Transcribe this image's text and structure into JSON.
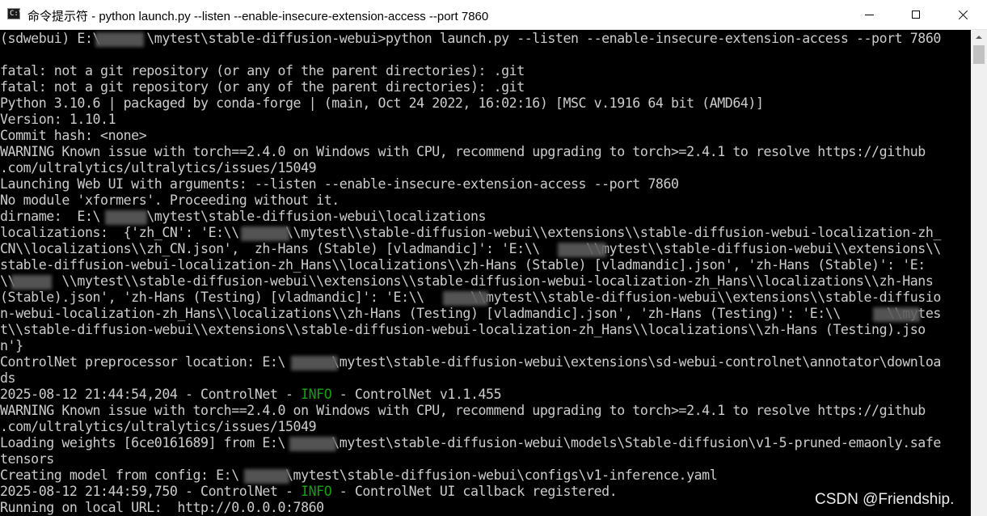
{
  "window": {
    "title": "命令提示符 - python  launch.py --listen --enable-insecure-extension-access --port 7860",
    "icon": "cmd-icon",
    "icon_glyph": "C:\\",
    "controls": [
      "minimize-icon",
      "maximize-icon",
      "close-icon"
    ]
  },
  "console": {
    "text_color": "#cccccc",
    "background": "#000000",
    "info_color": "#13a10e",
    "lines": [
      [
        {
          "t": "(sdwebui) E:\\      \\mytest\\stable-diffusion-webui>python launch.py --listen --enable-insecure-extension-access --port 7860"
        }
      ],
      [
        {
          "t": ""
        }
      ],
      [
        {
          "t": "fatal: not a git repository (or any of the parent directories): .git"
        }
      ],
      [
        {
          "t": "fatal: not a git repository (or any of the parent directories): .git"
        }
      ],
      [
        {
          "t": "Python 3.10.6 | packaged by conda-forge | (main, Oct 24 2022, 16:02:16) [MSC v.1916 64 bit (AMD64)]"
        }
      ],
      [
        {
          "t": "Version: 1.10.1"
        }
      ],
      [
        {
          "t": "Commit hash: <none>"
        }
      ],
      [
        {
          "t": "WARNING Known issue with torch==2.4.0 on Windows with CPU, recommend upgrading to torch>=2.4.1 to resolve https://github"
        }
      ],
      [
        {
          "t": ".com/ultralytics/ultralytics/issues/15049"
        }
      ],
      [
        {
          "t": "Launching Web UI with arguments: --listen --enable-insecure-extension-access --port 7860"
        }
      ],
      [
        {
          "t": "No module 'xformers'. Proceeding without it."
        }
      ],
      [
        {
          "t": "dirname:  E:\\      \\mytest\\stable-diffusion-webui\\localizations"
        }
      ],
      [
        {
          "t": "localizations:  {'zh_CN': 'E:\\\\      \\\\mytest\\\\stable-diffusion-webui\\\\extensions\\\\stable-diffusion-webui-localization-zh_"
        }
      ],
      [
        {
          "t": "CN\\\\localizations\\\\zh_CN.json',  zh-Hans (Stable) [vladmandic]': 'E:\\\\      \\\\mytest\\\\stable-diffusion-webui\\\\extensions\\\\"
        }
      ],
      [
        {
          "t": "stable-diffusion-webui-localization-zh_Hans\\\\localizations\\\\zh-Hans (Stable) [vladmandic].json', 'zh-Hans (Stable)': 'E:"
        }
      ],
      [
        {
          "t": "\\\\      \\\\mytest\\\\stable-diffusion-webui\\\\extensions\\\\stable-diffusion-webui-localization-zh_Hans\\\\localizations\\\\zh-Hans"
        }
      ],
      [
        {
          "t": "(Stable).json', 'zh-Hans (Testing) [vladmandic]': 'E:\\\\      \\\\mytest\\\\stable-diffusion-webui\\\\extensions\\\\stable-diffusio"
        }
      ],
      [
        {
          "t": "n-webui-localization-zh_Hans\\\\localizations\\\\zh-Hans (Testing) [vladmandic].json', 'zh-Hans (Testing)': 'E:\\\\      \\\\mytes"
        }
      ],
      [
        {
          "t": "t\\\\stable-diffusion-webui\\\\extensions\\\\stable-diffusion-webui-localization-zh_Hans\\\\localizations\\\\zh-Hans (Testing).jso"
        }
      ],
      [
        {
          "t": "n'}"
        }
      ],
      [
        {
          "t": "ControlNet preprocessor location: E:\\      \\mytest\\stable-diffusion-webui\\extensions\\sd-webui-controlnet\\annotator\\downloa"
        }
      ],
      [
        {
          "t": "ds"
        }
      ],
      [
        {
          "t": "2025-08-12 21:44:54,204 - ControlNet - "
        },
        {
          "t": "INFO",
          "c": "info"
        },
        {
          "t": " - ControlNet v1.1.455"
        }
      ],
      [
        {
          "t": "WARNING Known issue with torch==2.4.0 on Windows with CPU, recommend upgrading to torch>=2.4.1 to resolve https://github"
        }
      ],
      [
        {
          "t": ".com/ultralytics/ultralytics/issues/15049"
        }
      ],
      [
        {
          "t": "Loading weights [6ce0161689] from E:\\      \\mytest\\stable-diffusion-webui\\models\\Stable-diffusion\\v1-5-pruned-emaonly.safe"
        }
      ],
      [
        {
          "t": "tensors"
        }
      ],
      [
        {
          "t": "Creating model from config: E:\\      \\mytest\\stable-diffusion-webui\\configs\\v1-inference.yaml"
        }
      ],
      [
        {
          "t": "2025-08-12 21:44:59,750 - ControlNet - "
        },
        {
          "t": "INFO",
          "c": "info"
        },
        {
          "t": " - ControlNet UI callback registered."
        }
      ],
      [
        {
          "t": "Running on local URL:  http://0.0.0.0:7860"
        }
      ]
    ]
  },
  "watermark": "CSDN @Friendship."
}
